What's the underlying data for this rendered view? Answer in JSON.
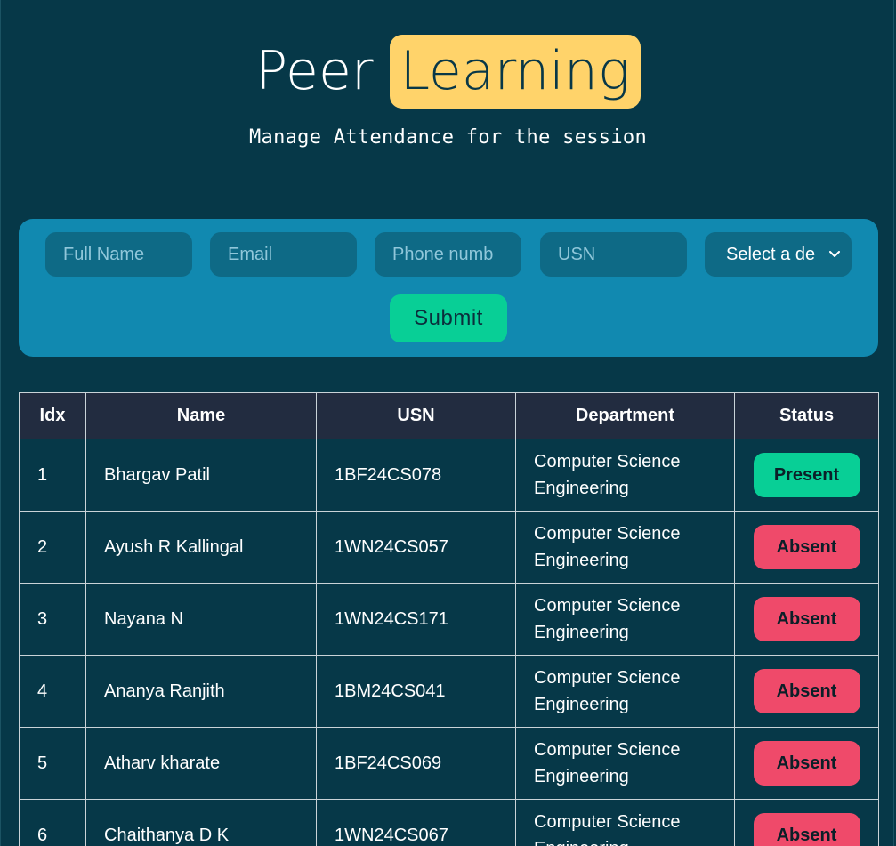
{
  "header": {
    "title_part1": "Peer",
    "title_part2": "Learning",
    "subtitle": "Manage Attendance for the session"
  },
  "form": {
    "full_name_placeholder": "Full Name",
    "email_placeholder": "Email",
    "phone_placeholder": "Phone numb",
    "usn_placeholder": "USN",
    "department_select_value": "Select a de",
    "submit_label": "Submit"
  },
  "table": {
    "columns": [
      "Idx",
      "Name",
      "USN",
      "Department",
      "Status"
    ],
    "rows": [
      {
        "idx": "1",
        "name": "Bhargav Patil",
        "usn": "1BF24CS078",
        "dept_line1": "Computer Science",
        "dept_line2": "Engineering",
        "status": "Present"
      },
      {
        "idx": "2",
        "name": "Ayush R Kallingal",
        "usn": "1WN24CS057",
        "dept_line1": "Computer Science",
        "dept_line2": "Engineering",
        "status": "Absent"
      },
      {
        "idx": "3",
        "name": "Nayana N",
        "usn": "1WN24CS171",
        "dept_line1": "Computer Science",
        "dept_line2": "Engineering",
        "status": "Absent"
      },
      {
        "idx": "4",
        "name": "Ananya Ranjith",
        "usn": "1BM24CS041",
        "dept_line1": "Computer Science",
        "dept_line2": "Engineering",
        "status": "Absent"
      },
      {
        "idx": "5",
        "name": "Atharv kharate",
        "usn": "1BF24CS069",
        "dept_line1": "Computer Science",
        "dept_line2": "Engineering",
        "status": "Absent"
      },
      {
        "idx": "6",
        "name": "Chaithanya D K",
        "usn": "1WN24CS067",
        "dept_line1": "Computer Science",
        "dept_line2": "Engineering",
        "status": "Absent"
      }
    ]
  },
  "colors": {
    "background": "#063848",
    "highlight": "#ffd36a",
    "form_panel": "#1189b0",
    "present": "#08cf96",
    "absent": "#ef4a6a",
    "table_header": "#222c40"
  }
}
